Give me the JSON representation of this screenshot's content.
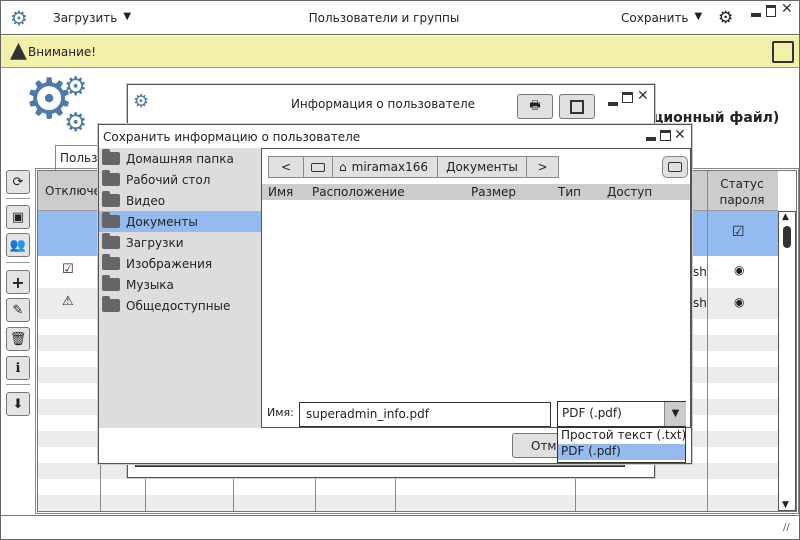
{
  "topbar": {
    "load_label": "Загрузить",
    "title": "Пользователи и группы",
    "save_label": "Сохранить"
  },
  "warning": {
    "text": "Внимание!"
  },
  "background": {
    "partial_text": "ционный файл)",
    "tab_label": "Пользо"
  },
  "table": {
    "headers": {
      "disabled": "Отключен",
      "password_status": "Статус пароля"
    },
    "partial_cells": [
      "sh",
      "sh"
    ]
  },
  "info_dialog": {
    "title": "Информация о пользователе"
  },
  "save_dialog": {
    "title": "Сохранить информацию о пользователе",
    "places": [
      "Домашняя папка",
      "Рабочий стол",
      "Видео",
      "Документы",
      "Загрузки",
      "Изображения",
      "Музыка",
      "Общедоступные"
    ],
    "selected_place": 3,
    "nav": {
      "back": "<",
      "home": "miramax166",
      "current": "Документы",
      "forward": ">"
    },
    "columns": [
      "Имя",
      "Расположение",
      "Размер",
      "Тип",
      "Доступ"
    ],
    "name_label": "Имя:",
    "filename": "superadmin_info.pdf",
    "filetype": "PDF (.pdf)",
    "filetype_options": [
      "Простой текст (.txt)",
      "PDF (.pdf)"
    ],
    "cancel_label": "Отмена"
  },
  "colors": {
    "accent": "#4f79ab",
    "selection": "#94baf0",
    "warning_bg": "#f3f0ac"
  }
}
